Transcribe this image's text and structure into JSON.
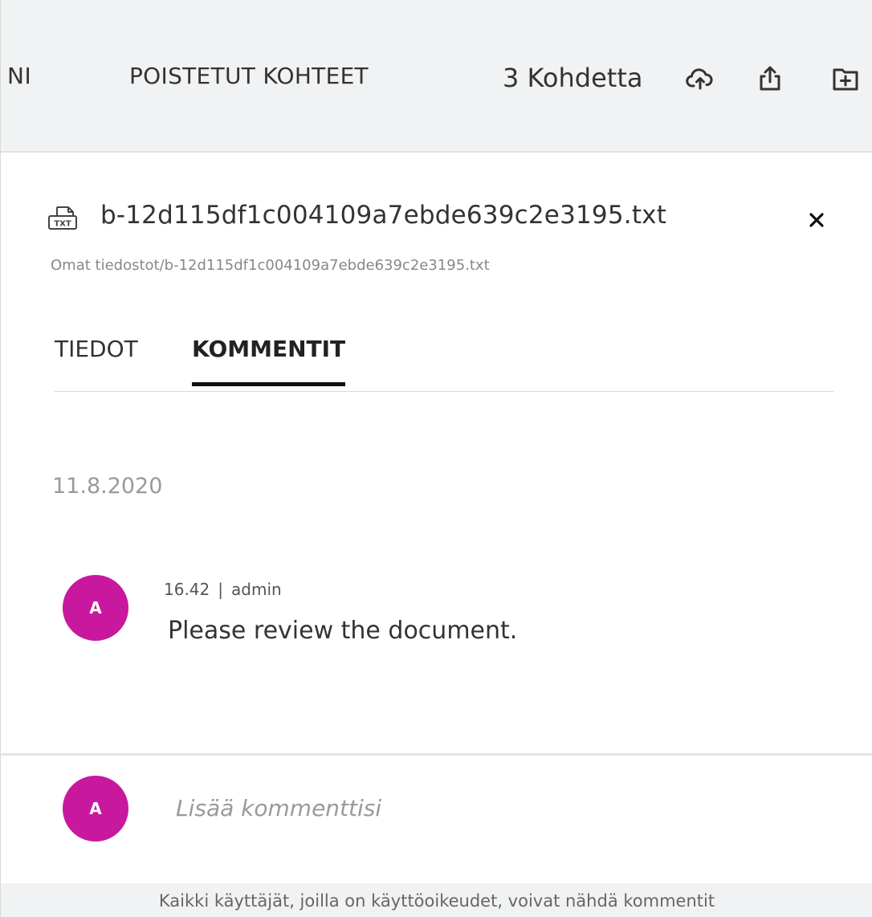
{
  "toolbar": {
    "partial_tab_label": "NI",
    "deleted_items_label": "POISTETUT KOHTEET",
    "item_count": "3 Kohdetta",
    "icons": [
      "cloud-upload-icon",
      "share-icon",
      "new-folder-icon"
    ]
  },
  "details": {
    "file_type_badge": "TXT",
    "file_name": "b-12d115df1c004109a7ebde639c2e3195.txt",
    "file_path": "Omat tiedostot/b-12d115df1c004109a7ebde639c2e3195.txt",
    "tabs": [
      {
        "label": "TIEDOT",
        "active": false
      },
      {
        "label": "KOMMENTIT",
        "active": true
      }
    ]
  },
  "comments": {
    "groups": [
      {
        "date": "11.8.2020",
        "items": [
          {
            "avatar_initial": "A",
            "time": "16.42",
            "separator": "|",
            "author": "admin",
            "text": "Please review the document."
          }
        ]
      }
    ]
  },
  "composer": {
    "avatar_initial": "A",
    "placeholder": "Lisää kommenttisi"
  },
  "footer": {
    "note": "Kaikki käyttäjät, joilla on käyttöoikeudet, voivat nähdä kommentit"
  },
  "colors": {
    "avatar": "#c8189e",
    "toolbar_bg": "#f1f2f3",
    "active_tab_underline": "#111111"
  }
}
